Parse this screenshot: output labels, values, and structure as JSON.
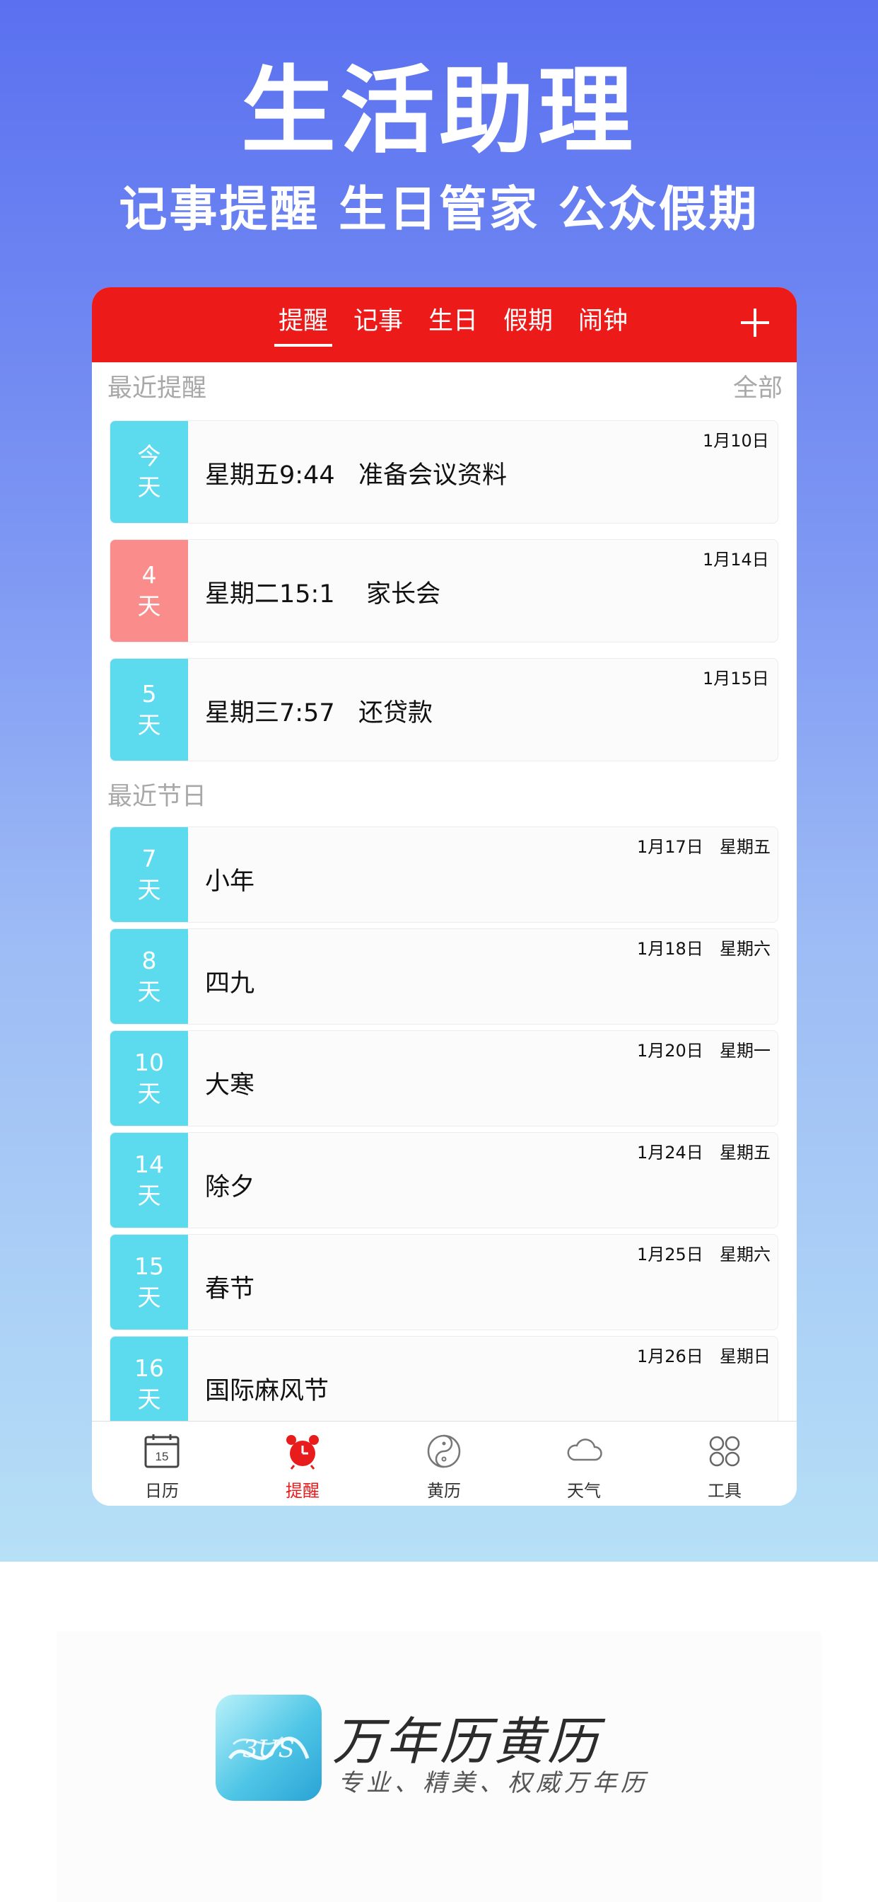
{
  "hero": {
    "title": "生活助理",
    "subtitle": "记事提醒  生日管家  公众假期"
  },
  "nav": {
    "tabs": [
      "提醒",
      "记事",
      "生日",
      "假期",
      "闹钟"
    ],
    "active": "提醒",
    "add_icon": "plus-icon"
  },
  "reminders": {
    "header": "最近提醒",
    "more": "全部",
    "items": [
      {
        "badge_top": "今",
        "badge_bottom": "天",
        "color": "#5cdbee",
        "text": "星期五9:44   准备会议资料",
        "date": "1月10日"
      },
      {
        "badge_top": "4",
        "badge_bottom": "天",
        "color": "#fa8c8c",
        "text": "星期二15:1    家长会",
        "date": "1月14日"
      },
      {
        "badge_top": "5",
        "badge_bottom": "天",
        "color": "#5cdbee",
        "text": "星期三7:57   还贷款",
        "date": "1月15日"
      }
    ]
  },
  "holidays": {
    "header": "最近节日",
    "items": [
      {
        "badge_top": "7",
        "badge_bottom": "天",
        "name": "小年",
        "date": "1月17日",
        "weekday": "星期五"
      },
      {
        "badge_top": "8",
        "badge_bottom": "天",
        "name": "四九",
        "date": "1月18日",
        "weekday": "星期六"
      },
      {
        "badge_top": "10",
        "badge_bottom": "天",
        "name": "大寒",
        "date": "1月20日",
        "weekday": "星期一"
      },
      {
        "badge_top": "14",
        "badge_bottom": "天",
        "name": "除夕",
        "date": "1月24日",
        "weekday": "星期五"
      },
      {
        "badge_top": "15",
        "badge_bottom": "天",
        "name": "春节",
        "date": "1月25日",
        "weekday": "星期六"
      },
      {
        "badge_top": "16",
        "badge_bottom": "天",
        "name": "国际麻风节",
        "date": "1月26日",
        "weekday": "星期日"
      }
    ]
  },
  "tabbar": {
    "items": [
      {
        "label": "日历",
        "icon": "calendar-icon",
        "icon_text": "15"
      },
      {
        "label": "提醒",
        "icon": "alarm-clock-icon"
      },
      {
        "label": "黄历",
        "icon": "yin-yang-icon"
      },
      {
        "label": "天气",
        "icon": "cloud-icon"
      },
      {
        "label": "工具",
        "icon": "grid-circles-icon"
      }
    ],
    "active": "提醒"
  },
  "brand": {
    "name": "万年历黄历",
    "slogan": "专业、精美、权威万年历",
    "logo_text": "3US"
  },
  "colors": {
    "nav_red": "#ed1a1a",
    "badge_cyan": "#5cdbee",
    "badge_pink": "#fa8c8c",
    "active_tab": "#e81c1c"
  }
}
